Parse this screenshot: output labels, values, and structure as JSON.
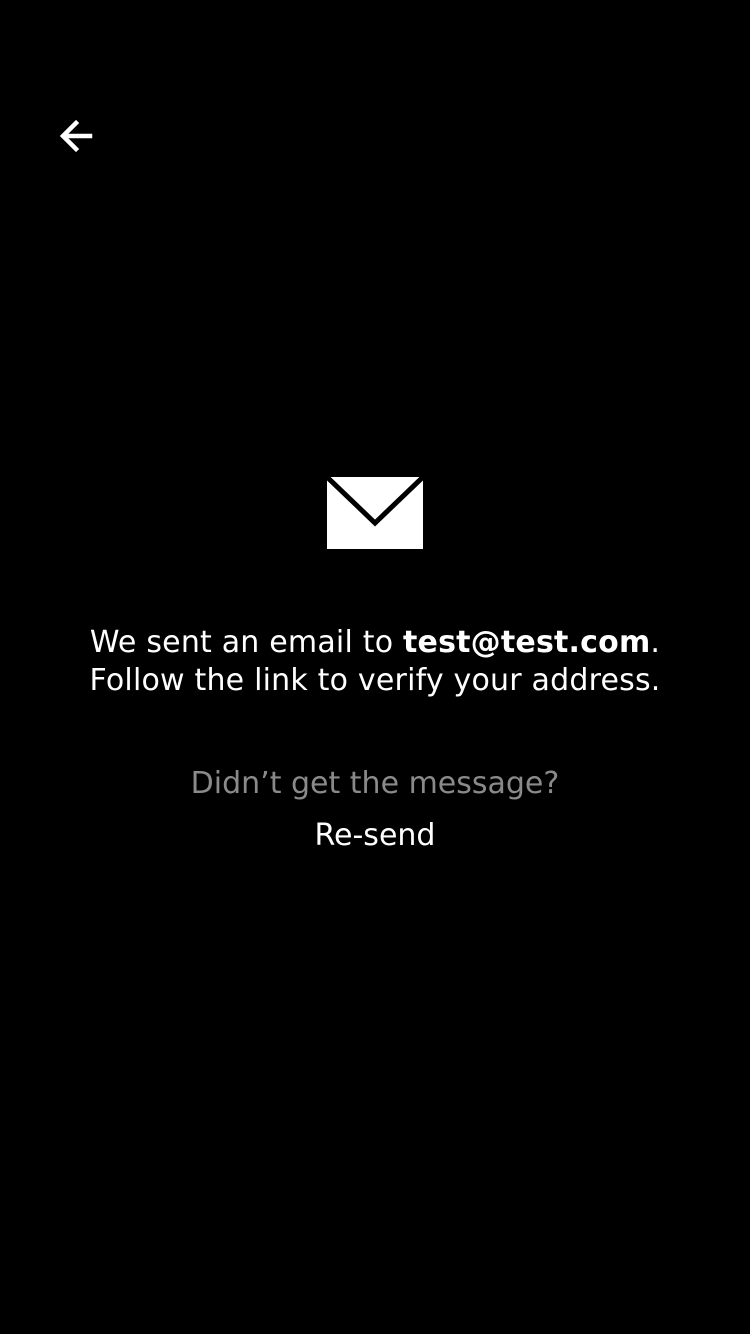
{
  "header": {
    "back_icon": "arrow-left-icon"
  },
  "main": {
    "icon": "envelope-icon",
    "message_prefix": "We sent an email to ",
    "email": "test@test.com",
    "message_suffix": ".",
    "message_line2": "Follow the link to verify your address.",
    "prompt": "Didn’t get the message?",
    "resend_label": "Re-send"
  },
  "colors": {
    "background": "#000000",
    "text": "#ffffff",
    "muted_text": "#8a8a8a"
  }
}
